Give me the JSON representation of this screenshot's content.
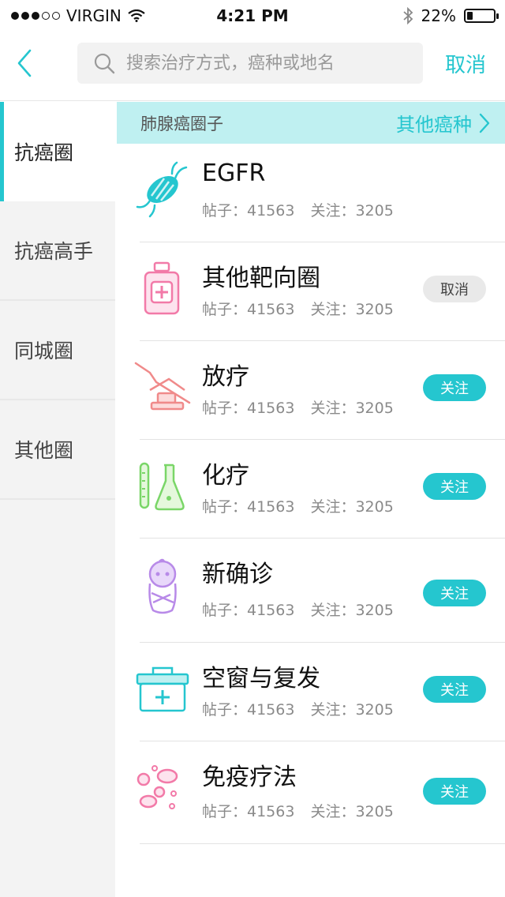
{
  "status_bar": {
    "carrier": "VIRGIN",
    "time": "4:21 PM",
    "battery": "22%",
    "battery_level": 0.22
  },
  "search": {
    "placeholder": "搜索治疗方式，癌种或地名",
    "cancel_label": "取消"
  },
  "sidebar": {
    "items": [
      {
        "label": "抗癌圈",
        "active": true
      },
      {
        "label": "抗癌高手"
      },
      {
        "label": "同城圈"
      },
      {
        "label": "其他圈"
      }
    ]
  },
  "category": {
    "title": "肺腺癌圈子",
    "other_label": "其他癌种"
  },
  "list": {
    "items": [
      {
        "name": "EGFR",
        "posts": "帖子：41563",
        "followers": "关注：3205",
        "button": "",
        "icon": "dna-icon"
      },
      {
        "name": "其他靶向圈",
        "posts": "帖子：41563",
        "followers": "关注：3205",
        "button": "取消",
        "icon": "medicine-bottle-icon"
      },
      {
        "name": "放疗",
        "posts": "帖子：41563",
        "followers": "关注：3205",
        "button": "关注",
        "icon": "radiotherapy-bed-icon"
      },
      {
        "name": "化疗",
        "posts": "帖子：41563",
        "followers": "关注：3205",
        "button": "关注",
        "icon": "flask-icon"
      },
      {
        "name": "新确诊",
        "posts": "帖子：41563",
        "followers": "关注：3205",
        "button": "关注",
        "icon": "baby-icon"
      },
      {
        "name": "空窗与复发",
        "posts": "帖子：41563",
        "followers": "关注：3205",
        "button": "关注",
        "icon": "first-aid-kit-icon"
      },
      {
        "name": "免疫疗法",
        "posts": "帖子：41563",
        "followers": "关注：3205",
        "button": "关注",
        "icon": "cells-icon"
      }
    ]
  },
  "colors": {
    "accent": "#25c6cf",
    "header_bg": "#bff0f1",
    "sidebar_bg": "#f3f3f3"
  }
}
